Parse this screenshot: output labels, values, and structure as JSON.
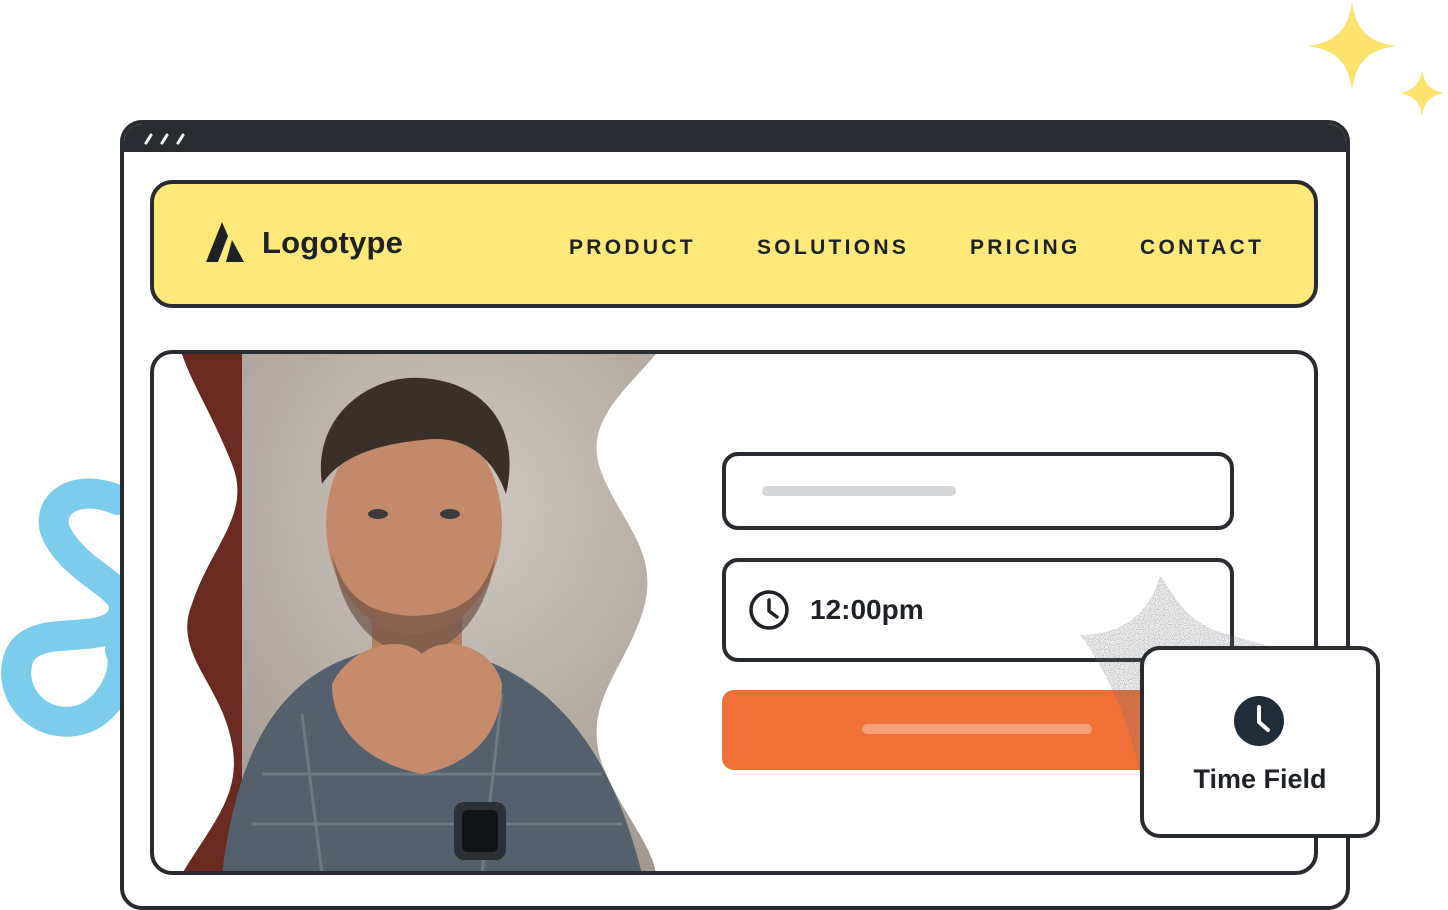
{
  "colors": {
    "ink": "#282b2f",
    "nav_background": "#fde87a",
    "accent_orange": "#f07038",
    "sparkle_yellow": "#fbe26c",
    "squiggle_blue": "#7ccdec"
  },
  "brand": {
    "logo_icon": "logo-mark-icon",
    "name": "Logotype"
  },
  "nav": {
    "items": [
      {
        "label": "PRODUCT"
      },
      {
        "label": "SOLUTIONS"
      },
      {
        "label": "PRICING"
      },
      {
        "label": "CONTACT"
      }
    ]
  },
  "form": {
    "text_field": {
      "icon": "none"
    },
    "time_field": {
      "icon": "clock-icon",
      "value": "12:00pm"
    },
    "submit": {
      "icon": "none"
    }
  },
  "tooltip": {
    "icon": "clock-icon",
    "label": "Time Field"
  }
}
